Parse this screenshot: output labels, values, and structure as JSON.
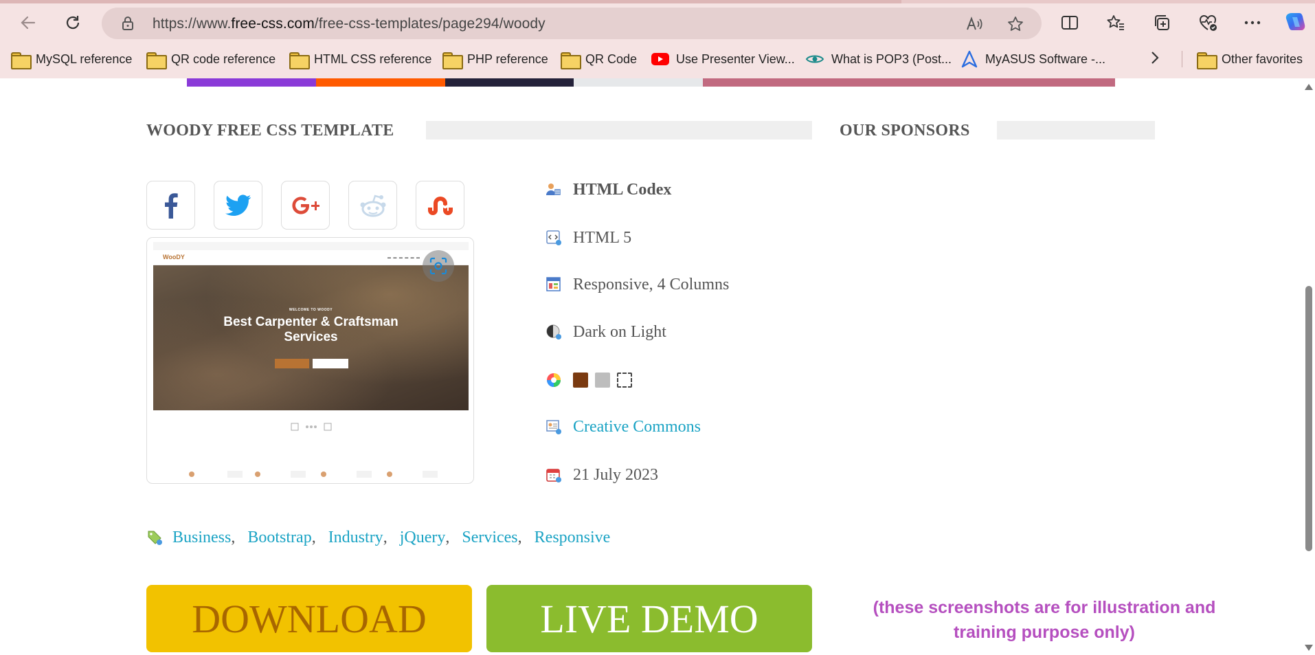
{
  "browser": {
    "url_prefix": "https://www.",
    "url_host": "free-css.com",
    "url_path": "/free-css-templates/page294/woody"
  },
  "bookmarks": [
    {
      "label": "MySQL reference",
      "icon": "folder-icon"
    },
    {
      "label": "QR code reference",
      "icon": "folder-icon"
    },
    {
      "label": "HTML CSS reference",
      "icon": "folder-icon"
    },
    {
      "label": "PHP reference",
      "icon": "folder-icon"
    },
    {
      "label": "QR Code",
      "icon": "folder-icon"
    },
    {
      "label": "Use Presenter View...",
      "icon": "youtube-icon"
    },
    {
      "label": "What is POP3 (Post...",
      "icon": "eye-icon"
    },
    {
      "label": "MyASUS Software -...",
      "icon": "asus-icon"
    },
    {
      "label": "Other favorites",
      "icon": "folder-icon"
    }
  ],
  "main": {
    "title": "WOODY FREE CSS TEMPLATE",
    "sponsors_title": "OUR SPONSORS",
    "share_icons": [
      "facebook-icon",
      "twitter-icon",
      "google-plus-icon",
      "reddit-icon",
      "stumbleupon-icon"
    ],
    "preview": {
      "logo": "WooDY",
      "welcome": "WELCOME TO WOODY",
      "heading_line1": "Best Carpenter & Craftsman",
      "heading_line2": "Services"
    },
    "info": {
      "author": "HTML Codex",
      "version": "HTML 5",
      "layout": "Responsive, 4 Columns",
      "scheme": "Dark on Light",
      "colors": [
        "#7a3a10",
        "#bdbdbd",
        "#ffffff"
      ],
      "license": "Creative Commons",
      "date": "21 July 2023"
    },
    "tags": [
      "Business",
      "Bootstrap",
      "Industry",
      "jQuery",
      "Services",
      "Responsive"
    ],
    "download_label": "DOWNLOAD",
    "demo_label": "LIVE DEMO",
    "note_line1": "(these screenshots are for illustration and",
    "note_line2": "training purpose only)",
    "colors": {
      "accent_link": "#1aa3c4",
      "download_bg": "#f2c200",
      "download_text": "#a86600",
      "demo_bg": "#8bbc2e",
      "note_color": "#b54fbf"
    }
  }
}
